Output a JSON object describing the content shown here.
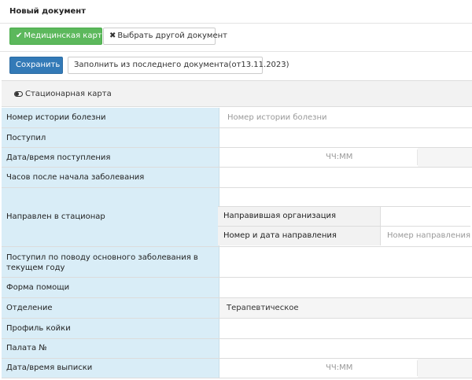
{
  "panel": {
    "title": "Новый документ"
  },
  "buttons": {
    "medical_card": "Медицинская карта",
    "choose_other": "Выбрать другой документ",
    "save": "Сохранить",
    "fill_from_last": "Заполнить из последнего документа(от13.11.2023)"
  },
  "section": {
    "title": "Стационарная карта"
  },
  "form": {
    "history_number": {
      "label": "Номер истории болезни",
      "placeholder": "Номер истории болезни"
    },
    "admitted": {
      "label": "Поступил"
    },
    "admission_datetime": {
      "label": "Дата/время поступления",
      "time_placeholder": "ЧЧ:ММ"
    },
    "hours_after_onset": {
      "label": "Часов после начала заболевания"
    },
    "referred": {
      "label": "Направлен в стационар",
      "org_label": "Направившая организация",
      "number_label": "Номер и дата направления",
      "number_placeholder": "Номер направления"
    },
    "main_disease": {
      "label": "Поступил по поводу основного заболевания в текущем году"
    },
    "care_form": {
      "label": "Форма помощи"
    },
    "department": {
      "label": "Отделение",
      "value": "Терапевтическое"
    },
    "bed_profile": {
      "label": "Профиль койки"
    },
    "ward": {
      "label": "Палата №"
    },
    "discharge_datetime": {
      "label": "Дата/время выписки",
      "time_placeholder": "ЧЧ:ММ"
    }
  },
  "colors": {
    "primary": "#337ab7",
    "success": "#5cb85c",
    "label_bg": "#d9edf7"
  }
}
